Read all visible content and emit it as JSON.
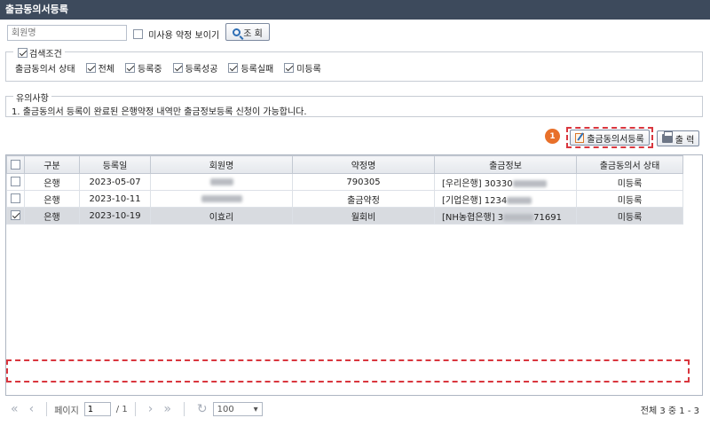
{
  "title": "출금동의서등록",
  "search": {
    "placeholder": "회원명",
    "show_unused_label": "미사용 약정 보이기",
    "search_button": "조 회"
  },
  "conditions": {
    "legend": "검색조건",
    "status_label": "출금동의서 상태",
    "options": [
      "전체",
      "등록중",
      "등록성공",
      "등록실패",
      "미등록"
    ]
  },
  "notice": {
    "legend": "유의사항",
    "text": "1. 출금동의서 등록이 완료된 은행약정 내역만 출금정보등록 신청이 가능합니다."
  },
  "toolbar": {
    "badge": "1",
    "register_button": "출금동의서등록",
    "print_button": "출 력"
  },
  "table": {
    "columns": [
      "구분",
      "등록일",
      "회원명",
      "약정명",
      "출금정보",
      "출금동의서 상태"
    ],
    "rows": [
      {
        "type": "은행",
        "date": "2023-05-07",
        "member": "",
        "contract": "790305",
        "account_prefix": "[우리은행] 30330",
        "account_suffix": "",
        "status": "미등록",
        "selected": false
      },
      {
        "type": "은행",
        "date": "2023-10-11",
        "member": "",
        "contract": "출금약정",
        "account_prefix": "[기업은행] 1234",
        "account_suffix": "",
        "status": "미등록",
        "selected": false
      },
      {
        "type": "은행",
        "date": "2023-10-19",
        "member": "이효리",
        "contract": "월회비",
        "account_prefix": "[NH농협은행] 3",
        "account_suffix": "71691",
        "status": "미등록",
        "selected": true
      }
    ]
  },
  "pager": {
    "page_label": "페이지",
    "page_value": "1",
    "page_total": "/ 1",
    "page_size": "100",
    "summary": "전체 3 중 1 - 3"
  }
}
